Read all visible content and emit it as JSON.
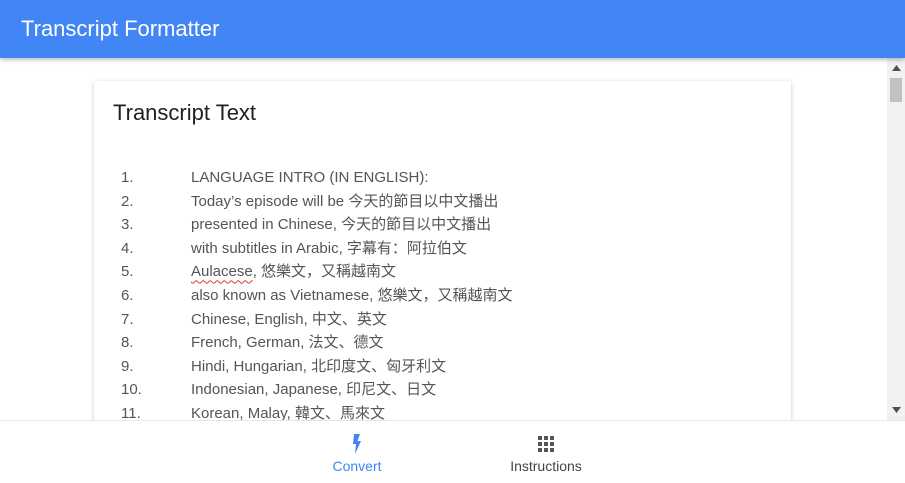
{
  "app": {
    "title": "Transcript Formatter",
    "accent_color": "#4285f4"
  },
  "card": {
    "title": "Transcript Text",
    "lines": [
      {
        "num": "1.",
        "text": "LANGUAGE INTRO (IN ENGLISH):"
      },
      {
        "num": "2.",
        "text": "Today’s episode will be   今天的節目以中文播出"
      },
      {
        "num": "3.",
        "text": "presented in Chinese,     今天的節目以中文播出"
      },
      {
        "num": "4.",
        "text": "with subtitles in Arabic,   字幕有：阿拉伯文"
      },
      {
        "num": "5.",
        "text_misspelled": "Aulacese",
        "text": ",        悠樂文，又稱越南文"
      },
      {
        "num": "6.",
        "text": "also known as Vietnamese,     悠樂文，又稱越南文"
      },
      {
        "num": "7.",
        "text": "Chinese, English,     中文、英文"
      },
      {
        "num": "8.",
        "text": "French, German,     法文、德文"
      },
      {
        "num": "9.",
        "text": "Hindi, Hungarian,     北印度文、匈牙利文"
      },
      {
        "num": "10.",
        "text": "Indonesian, Japanese,     印尼文、日文"
      },
      {
        "num": "11.",
        "text": "Korean, Malay,         韓文、馬來文"
      }
    ]
  },
  "bottom_nav": {
    "items": [
      {
        "label": "Convert",
        "icon": "lightning-bolt-icon",
        "active": true
      },
      {
        "label": "Instructions",
        "icon": "grid-icon",
        "active": false
      }
    ]
  },
  "scrollbar": {
    "up_icon": "triangle-up-icon",
    "down_icon": "triangle-down-icon"
  }
}
